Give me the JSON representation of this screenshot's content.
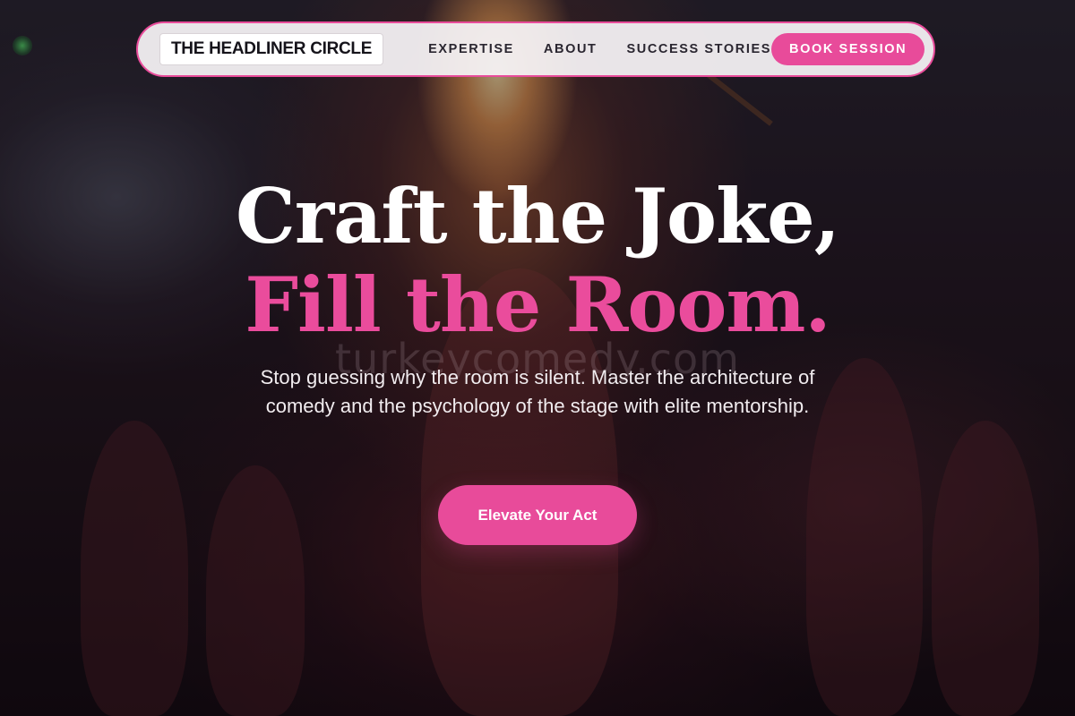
{
  "colors": {
    "accent": "#e84b9a",
    "headline_primary": "#ffffff",
    "headline_accent": "#ea4c9c",
    "nav_bg": "#f5f2f4",
    "nav_text": "#2a2630"
  },
  "nav": {
    "logo": "THE HEADLINER CIRCLE",
    "links": [
      {
        "label": "EXPERTISE"
      },
      {
        "label": "ABOUT"
      },
      {
        "label": "SUCCESS STORIES"
      }
    ],
    "cta_label": "BOOK SESSION"
  },
  "hero": {
    "headline_line1": "Craft the Joke,",
    "headline_line2": "Fill the Room.",
    "watermark": "turkeycomedy.com",
    "subtitle": "Stop guessing why the room is silent. Master the architecture of comedy and the psychology of the stage with elite mentorship.",
    "cta_label": "Elevate Your Act"
  }
}
